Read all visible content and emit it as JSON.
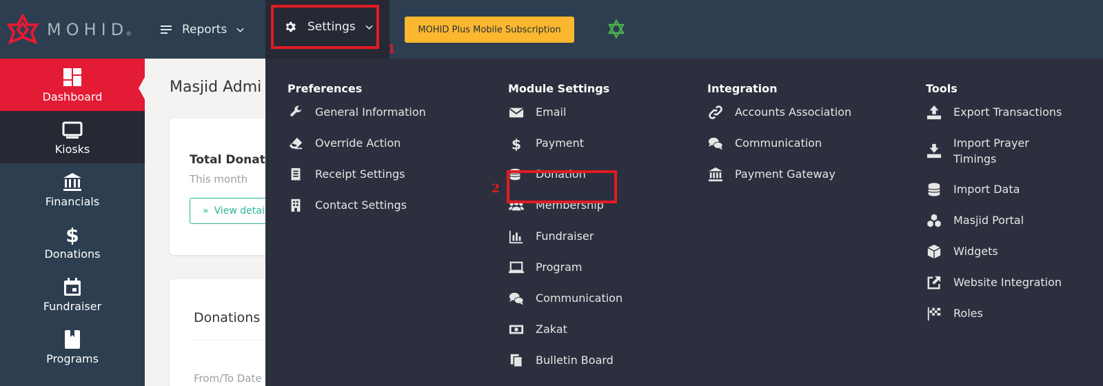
{
  "brand": {
    "name": "MOHID",
    "reg": "®"
  },
  "topnav": {
    "reports_label": "Reports",
    "settings_label": "Settings",
    "subscription_label": "MOHID Plus Mobile Subscription"
  },
  "annotations": {
    "step1": "1",
    "step2": "2"
  },
  "sidebar": {
    "items": [
      {
        "label": "Dashboard",
        "icon": "dashboard-icon"
      },
      {
        "label": "Kiosks",
        "icon": "monitor-icon"
      },
      {
        "label": "Financials",
        "icon": "bank-icon"
      },
      {
        "label": "Donations",
        "icon": "dollar-icon"
      },
      {
        "label": "Fundraiser",
        "icon": "calendar-icon"
      },
      {
        "label": "Programs",
        "icon": "book-icon"
      }
    ]
  },
  "main": {
    "title": "Masjid Admi",
    "card1": {
      "title": "Total Donatio",
      "subtitle": "This month",
      "link": "View detai"
    },
    "card2": {
      "title": "Donations",
      "from_to": "From/To Date"
    }
  },
  "menu": {
    "preferences": {
      "heading": "Preferences",
      "items": [
        {
          "label": "General Information",
          "icon": "wrench-icon"
        },
        {
          "label": "Override Action",
          "icon": "eraser-icon"
        },
        {
          "label": "Receipt Settings",
          "icon": "receipt-icon"
        },
        {
          "label": "Contact Settings",
          "icon": "building-icon"
        }
      ]
    },
    "module": {
      "heading": "Module Settings",
      "items": [
        {
          "label": "Email",
          "icon": "envelope-icon"
        },
        {
          "label": "Payment",
          "icon": "dollar-icon"
        },
        {
          "label": "Donation",
          "icon": "coins-icon"
        },
        {
          "label": "Membership",
          "icon": "users-icon"
        },
        {
          "label": "Fundraiser",
          "icon": "bar-chart-icon"
        },
        {
          "label": "Program",
          "icon": "laptop-icon"
        },
        {
          "label": "Communication",
          "icon": "comments-icon"
        },
        {
          "label": "Zakat",
          "icon": "money-bill-icon"
        },
        {
          "label": "Bulletin Board",
          "icon": "copy-icon"
        }
      ]
    },
    "integration": {
      "heading": "Integration",
      "items": [
        {
          "label": "Accounts Association",
          "icon": "link-icon"
        },
        {
          "label": "Communication",
          "icon": "comments-icon"
        },
        {
          "label": "Payment Gateway",
          "icon": "bank-icon"
        }
      ]
    },
    "tools": {
      "heading": "Tools",
      "items": [
        {
          "label": "Export Transactions",
          "icon": "upload-icon"
        },
        {
          "label": "Import Prayer Timings",
          "icon": "download-icon"
        },
        {
          "label": "Import Data",
          "icon": "database-icon"
        },
        {
          "label": "Masjid Portal",
          "icon": "cubes-icon"
        },
        {
          "label": "Widgets",
          "icon": "cube-icon"
        },
        {
          "label": "Website Integration",
          "icon": "external-link-icon"
        },
        {
          "label": "Roles",
          "icon": "flag-checkered-icon"
        }
      ]
    }
  },
  "colors": {
    "topbar": "#2c3e50",
    "menu_bg": "#2c2f3d",
    "accent_red": "#e31b35",
    "highlight_red": "#e31b23",
    "subscription_yellow": "#fbb72f",
    "teal": "#2bb59a"
  }
}
